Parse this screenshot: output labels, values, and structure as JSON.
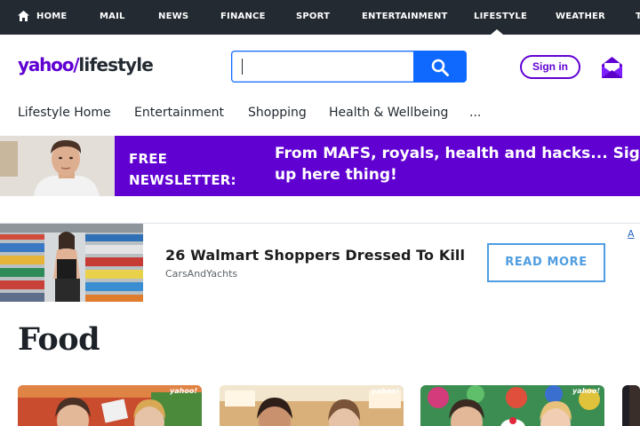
{
  "topnav": {
    "items": [
      "HOME",
      "MAIL",
      "NEWS",
      "FINANCE",
      "SPORT",
      "ENTERTAINMENT",
      "LIFESTYLE",
      "WEATHER",
      "T"
    ],
    "active": "LIFESTYLE"
  },
  "header": {
    "logo_brand": "yahoo",
    "logo_slash": "/",
    "logo_section": "lifestyle",
    "search_value": "",
    "search_icon": "search-icon",
    "signin_label": "Sign in",
    "mail_icon": "mail-icon"
  },
  "subnav": {
    "items": [
      "Lifestyle Home",
      "Entertainment",
      "Shopping",
      "Health & Wellbeing",
      "..."
    ]
  },
  "banner": {
    "free_line1": "FREE",
    "free_line2": "NEWSLETTER:",
    "headline": "From MAFS, royals, health and hacks... Sign up here thing!"
  },
  "ad": {
    "title": "26 Walmart Shoppers Dressed To Kill",
    "source": "CarsAndYachts",
    "cta": "READ MORE",
    "choice": "A"
  },
  "main": {
    "title": "Food"
  },
  "cards": {
    "watermark": "yahoo!"
  },
  "colors": {
    "nav_bg": "#232a31",
    "brand_purple": "#6001d2",
    "search_blue": "#0f69ff",
    "ad_blue": "#4f9de0"
  }
}
